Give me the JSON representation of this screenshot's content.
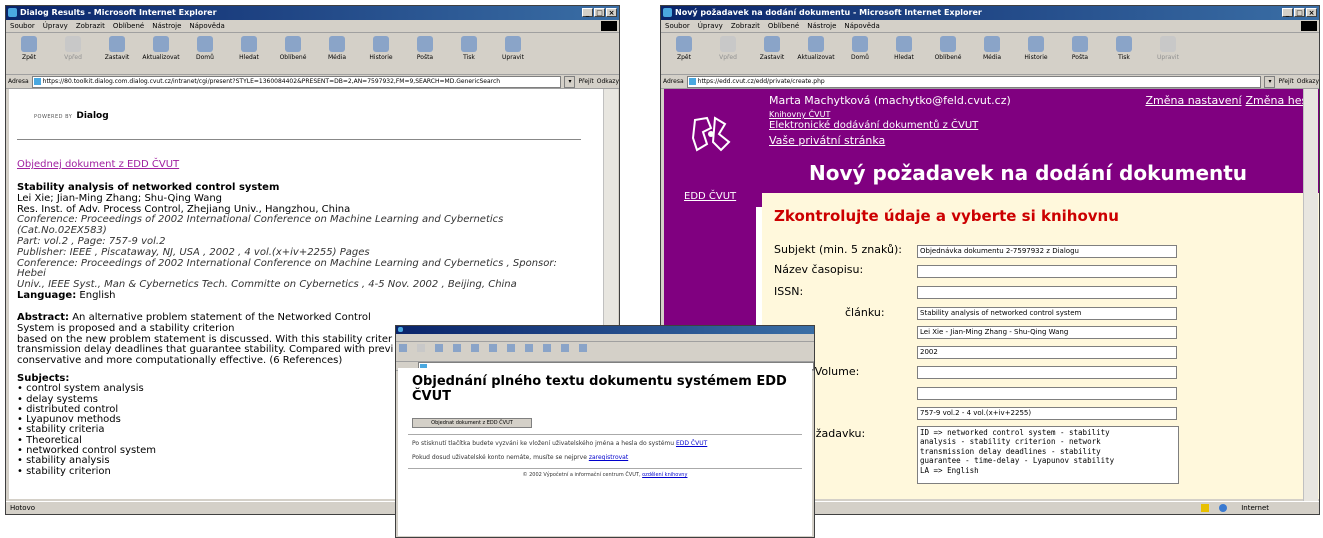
{
  "common": {
    "menu": [
      "Soubor",
      "Úpravy",
      "Zobrazit",
      "Oblíbené",
      "Nástroje",
      "Nápověda"
    ],
    "address_label": "Adresa",
    "go_label": "Přejít",
    "links_label": "Odkazy"
  },
  "win1": {
    "title": "Dialog Results - Microsoft Internet Explorer",
    "toolbar": [
      "Zpět",
      "Vpřed",
      "Zastavit",
      "Aktualizovat",
      "Domů",
      "Hledat",
      "Oblíbené",
      "Média",
      "Historie",
      "Pošta",
      "Tisk",
      "Upravit"
    ],
    "url": "https://80.toolkit.dialog.com.dialog.cvut.cz/intranet/cgi/present?STYLE=1360084402&PRESENT=DB=2,AN=7597932,FM=9,SEARCH=MD.GenericSearch",
    "status": "Hotovo",
    "logo_small": "POWERED BY",
    "logo_text": "Dialog",
    "order_link": "Objednej dokument z EDD ČVUT",
    "record": {
      "title": "Stability analysis of networked control system",
      "authors": "Lei Xie; Jian-Ming Zhang; Shu-Qing Wang",
      "affiliation": "Res. Inst. of Adv. Process Control, Zhejiang Univ., Hangzhou, China",
      "conf1": "Conference: Proceedings of 2002 International Conference on Machine Learning and Cybernetics (Cat.No.02EX583)",
      "part": "Part: vol.2 , Page: 757-9 vol.2",
      "publisher": "Publisher: IEEE , Piscataway, NJ, USA , 2002 , 4 vol.(x+iv+2255) Pages",
      "conf2a": "Conference: Proceedings of 2002 International Conference on Machine Learning and Cybernetics , Sponsor: Hebei",
      "conf2b": "Univ., IEEE Syst., Man & Cybernetics Tech. Committe on Cybernetics , 4-5 Nov. 2002 , Beijing, China",
      "language_label": "Language:",
      "language": "English"
    },
    "abstract_label": "Abstract:",
    "abstract_l1": "An alternative problem statement of the Networked Control System is proposed and a stability criterion",
    "abstract_l2": "based on the new problem statement is discussed. With this stability criter",
    "abstract_l3": "transmission delay deadlines that guarantee stability. Compared with previ",
    "abstract_l4": "conservative and more computationally effective. (6 References)",
    "subjects_label": "Subjects:",
    "subjects": [
      "control system analysis",
      "delay systems",
      "distributed control",
      "Lyapunov methods",
      "stability criteria",
      "Theoretical",
      "networked control system",
      "stability analysis",
      "stability criterion"
    ]
  },
  "win2": {
    "title": "Nový požadavek na dodání dokumentu - Microsoft Internet Explorer",
    "toolbar": [
      "Zpět",
      "Vpřed",
      "Zastavit",
      "Aktualizovat",
      "Domů",
      "Hledat",
      "Oblíbené",
      "Média",
      "Historie",
      "Pošta",
      "Tisk",
      "Upravit"
    ],
    "url": "https://edd.cvut.cz/edd/private/create.php",
    "status_zone": "Internet",
    "user": "Marta Machytková (machytko@feld.cvut.cz)",
    "link_knihovny": "Knihovny ČVUT",
    "link_edd": "Elektronické dodávání dokumentů z ČVUT",
    "link_private": "Vaše privátní stránka",
    "link_settings": "Změna nastavení",
    "link_password": "Změna hesla",
    "heading": "Nový požadavek na dodání dokumentu",
    "edd_link": "EDD ČVUT",
    "panel_heading": "Zkontrolujte údaje a vyberte si knihovnu",
    "labels": {
      "subjekt": "Subjekt (min. 5 znaků):",
      "nazev": "Název časopisu:",
      "issn": "ISSN:",
      "clanku": "článku:",
      "volume": "/Volume:",
      "colon": ":",
      "pozadavku": "požadavku:"
    },
    "values": {
      "subjekt": "Objednávka dokumentu 2-7597932 z Dialogu",
      "clanku": "Stability analysis of networked control system",
      "autori": "Lei Xie - Jian-Ming Zhang - Shu-Qing Wang",
      "rok": "2002",
      "strany": "757-9 vol.2 - 4 vol.(x+iv+2255)",
      "pozadavku": "ID => networked control system - stability\nanalysis - stability criterion - network\ntransmission delay deadlines - stability\nguarantee - time-delay - Lyapunov stability\nLA => English"
    }
  },
  "win3": {
    "heading": "Objednání plného textu dokumentu systémem EDD ČVUT",
    "button": "Objednat dokument z EDD ČVUT",
    "p1": "Po stisknutí tlačítka budete vyzváni ke vložení uživatelského jména a hesla do systému",
    "p1_link": "EDD ČVUT",
    "p2": "Pokud dosud uživatelské konto nemáte, musíte se nejprve",
    "p2_link": "zaregistrovat",
    "footer": "© 2002 Výpočetní a informační centrum ČVUT,",
    "footer_link": "ozdělení knihovny"
  }
}
